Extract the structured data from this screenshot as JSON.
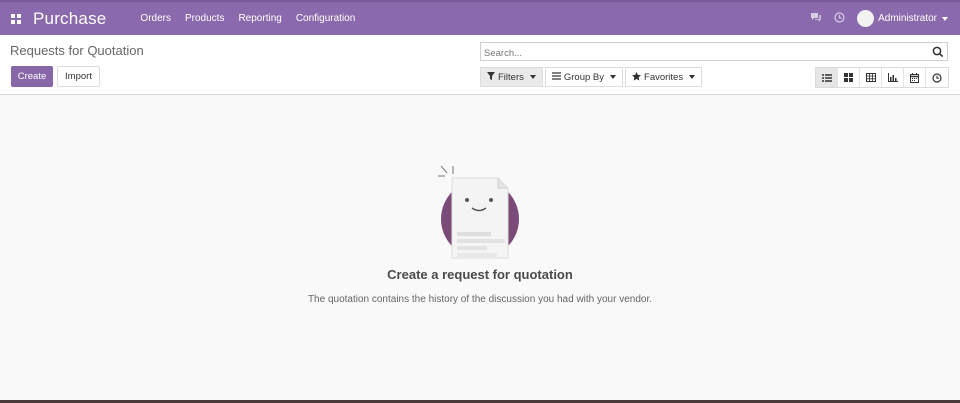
{
  "navbar": {
    "app_name": "Purchase",
    "menu": [
      "Orders",
      "Products",
      "Reporting",
      "Configuration"
    ],
    "user_name": "Administrator",
    "colors": {
      "navbar_bg": "#8a6aac",
      "primary_button": "#8867a8"
    }
  },
  "control_panel": {
    "title": "Requests for Quotation",
    "create_label": "Create",
    "import_label": "Import",
    "search_placeholder": "Search...",
    "filters_label": "Filters",
    "group_by_label": "Group By",
    "favorites_label": "Favorites",
    "views": [
      "list-view-icon",
      "kanban-view-icon",
      "pivot-view-icon",
      "graph-view-icon",
      "calendar-view-icon",
      "activity-view-icon"
    ],
    "active_view": "list-view-icon"
  },
  "empty_state": {
    "title": "Create a request for quotation",
    "text": "The quotation contains the history of the discussion you had with your vendor."
  }
}
